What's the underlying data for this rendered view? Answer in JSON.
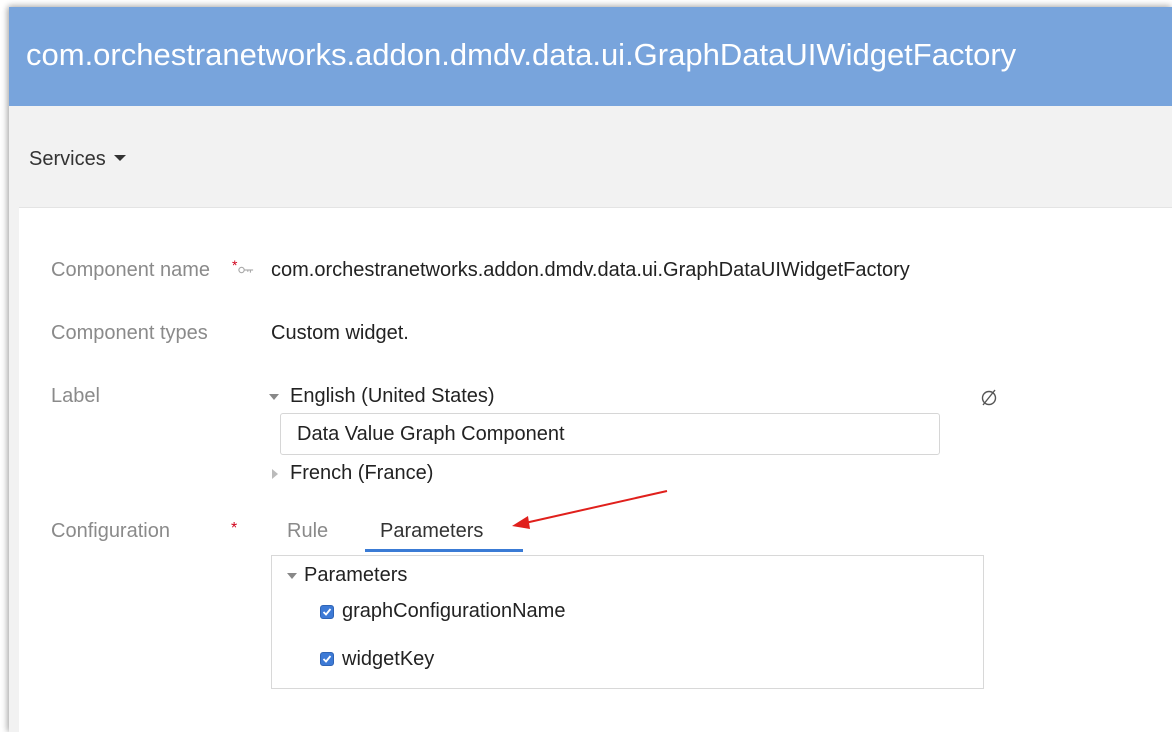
{
  "header": {
    "title": "com.orchestranetworks.addon.dmdv.data.ui.GraphDataUIWidgetFactory"
  },
  "menu": {
    "services_label": "Services"
  },
  "form": {
    "component_name": {
      "label": "Component name",
      "required_mark": "*",
      "value": "com.orchestranetworks.addon.dmdv.data.ui.GraphDataUIWidgetFactory"
    },
    "component_types": {
      "label": "Component types",
      "value": "Custom widget."
    },
    "label_field": {
      "label": "Label",
      "empty_icon": "∅",
      "locales": [
        {
          "name": "English (United States)",
          "expanded": true,
          "value": "Data Value Graph Component"
        },
        {
          "name": "French (France)",
          "expanded": false
        }
      ]
    },
    "configuration": {
      "label": "Configuration",
      "required_mark": "*",
      "tabs": [
        {
          "label": "Rule",
          "active": false
        },
        {
          "label": "Parameters",
          "active": true
        }
      ],
      "parameters_group": "Parameters",
      "parameters": [
        {
          "name": "graphConfigurationName",
          "checked": true
        },
        {
          "name": "widgetKey",
          "checked": true
        }
      ]
    }
  },
  "colors": {
    "title_bar": "#78a4dc",
    "accent": "#3a7bd5",
    "required": "#d0021b",
    "annotation_arrow": "#e0201c"
  }
}
